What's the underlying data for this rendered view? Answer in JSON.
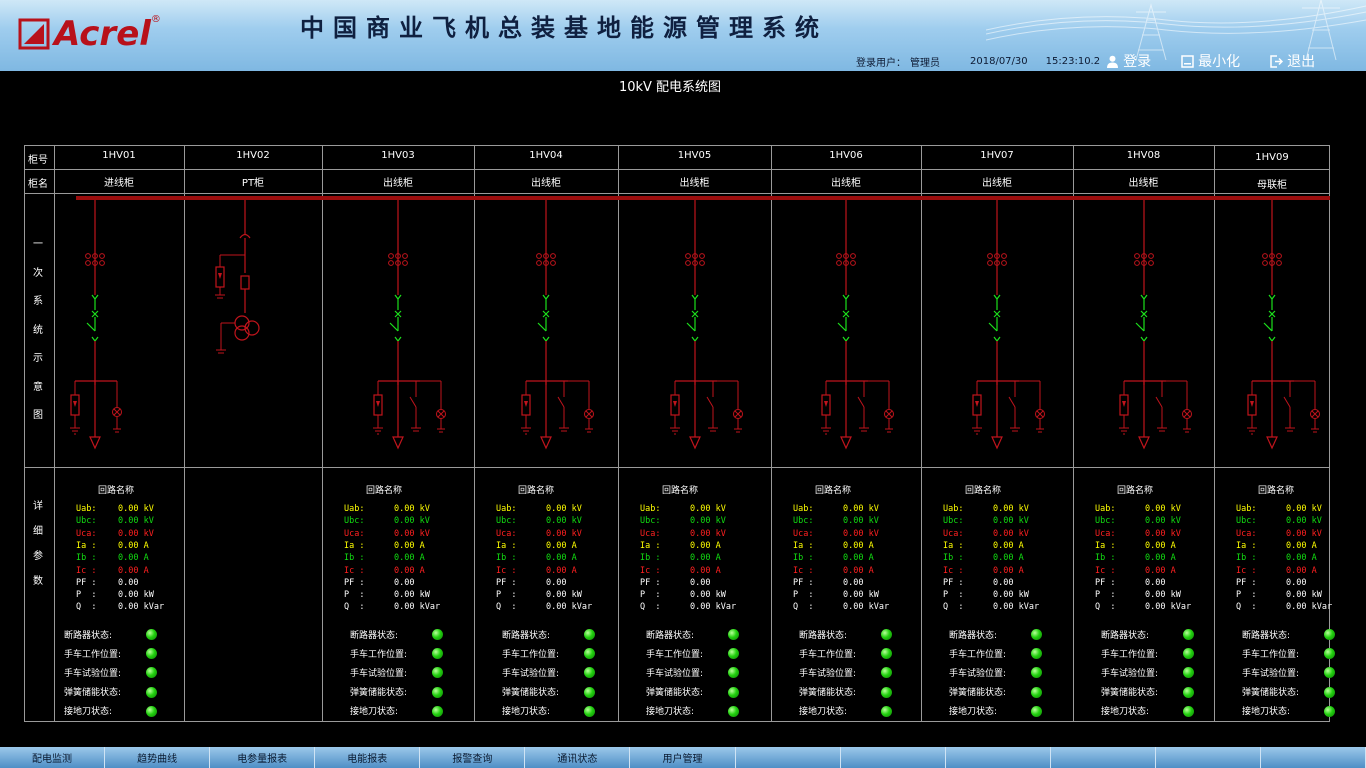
{
  "app": {
    "title": "中国商业飞机总装基地能源管理系统",
    "logo_text": "Acrel",
    "logo_reg": "®"
  },
  "status": {
    "login_label": "登录用户：",
    "user": "管理员",
    "date": "2018/07/30",
    "time": "15:23:10.2"
  },
  "header_buttons": {
    "login": "登录",
    "minimize": "最小化",
    "exit": "退出"
  },
  "diagram_title": "10kV 配电系统图",
  "row_headers": {
    "cabinet_no": "柜号",
    "cabinet_name": "柜名",
    "primary_diagram": [
      "一",
      "次",
      "系",
      "统",
      "示",
      "意",
      "图"
    ],
    "detail_params": [
      "详",
      "细",
      "参",
      "数"
    ]
  },
  "cabinets": [
    {
      "no": "1HV01",
      "name": "进线柜",
      "has_params": true
    },
    {
      "no": "1HV02",
      "name": "PT柜",
      "has_params": false
    },
    {
      "no": "1HV03",
      "name": "出线柜",
      "has_params": true
    },
    {
      "no": "1HV04",
      "name": "出线柜",
      "has_params": true
    },
    {
      "no": "1HV05",
      "name": "出线柜",
      "has_params": true
    },
    {
      "no": "1HV06",
      "name": "出线柜",
      "has_params": true
    },
    {
      "no": "1HV07",
      "name": "出线柜",
      "has_params": true
    },
    {
      "no": "1HV08",
      "name": "出线柜",
      "has_params": true
    },
    {
      "no": "1HV09",
      "name": "母联柜",
      "has_params": true
    }
  ],
  "param_header": "回路名称",
  "params": [
    {
      "label": "Uab:",
      "value": "0.00 kV",
      "color": "#ffff00",
      "value_color": "#ffff00"
    },
    {
      "label": "Ubc:",
      "value": "0.00 kV",
      "color": "#11dd11",
      "value_color": "#11dd11"
    },
    {
      "label": "Uca:",
      "value": "0.00 kV",
      "color": "#ff2020",
      "value_color": "#ff2020"
    },
    {
      "label": "Ia :",
      "value": "0.00 A",
      "color": "#ffff00",
      "value_color": "#ffff00"
    },
    {
      "label": "Ib :",
      "value": "0.00 A",
      "color": "#11dd11",
      "value_color": "#11dd11"
    },
    {
      "label": "Ic :",
      "value": "0.00 A",
      "color": "#ff2020",
      "value_color": "#ff2020"
    },
    {
      "label": "PF :",
      "value": "0.00",
      "color": "#ffffff",
      "value_color": "#ffffff"
    },
    {
      "label": "P  :",
      "value": "0.00 kW",
      "color": "#ffffff",
      "value_color": "#ffffff"
    },
    {
      "label": "Q  :",
      "value": "0.00 kVar",
      "color": "#ffffff",
      "value_color": "#ffffff"
    }
  ],
  "status_items": [
    "断路器状态:",
    "手车工作位置:",
    "手车试验位置:",
    "弹簧储能状态:",
    "接地刀状态:"
  ],
  "tabs": [
    "配电监测",
    "趋势曲线",
    "电参量报表",
    "电能报表",
    "报警查询",
    "通讯状态",
    "用户管理",
    "",
    "",
    "",
    "",
    "",
    ""
  ],
  "colors": {
    "header_bg": "#9fcdee",
    "busbar": "#9b0d0d",
    "diagram_red": "#c0141c",
    "switch_green": "#1ce01c",
    "grid_line": "#9a9a9a",
    "footer_bg": "#6fa7d6"
  }
}
